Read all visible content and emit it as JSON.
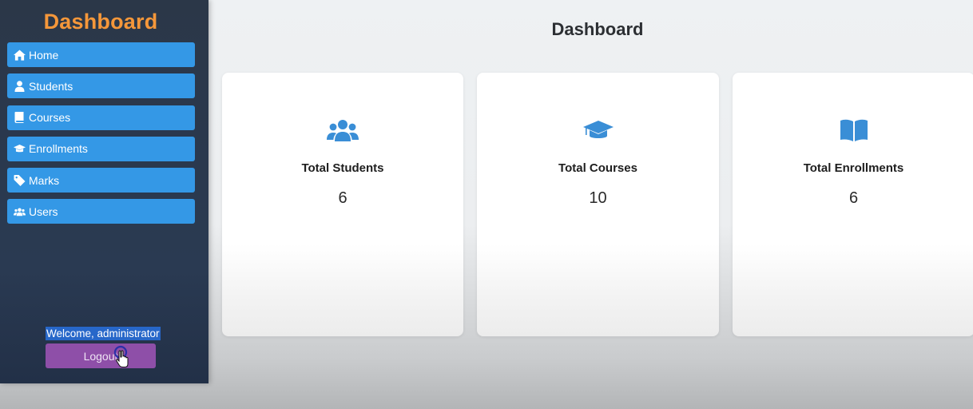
{
  "sidebar": {
    "brand": "Dashboard",
    "items": [
      {
        "label": "Home",
        "icon": "home-icon"
      },
      {
        "label": "Students",
        "icon": "user-icon"
      },
      {
        "label": "Courses",
        "icon": "book-icon"
      },
      {
        "label": "Enrollments",
        "icon": "graduation-cap-icon"
      },
      {
        "label": "Marks",
        "icon": "tag-icon"
      },
      {
        "label": "Users",
        "icon": "users-icon"
      }
    ],
    "welcome": "Welcome, administrator",
    "logout": "Logout"
  },
  "main": {
    "title": "Dashboard",
    "cards": [
      {
        "label": "Total Students",
        "value": "6",
        "icon": "users-icon"
      },
      {
        "label": "Total Courses",
        "value": "10",
        "icon": "graduation-cap-icon"
      },
      {
        "label": "Total Enrollments",
        "value": "6",
        "icon": "open-book-icon"
      }
    ]
  },
  "colors": {
    "sidebar_bg": "#2b3748",
    "brand": "#f5973a",
    "menu_button": "#3498e6",
    "logout_button": "#8e4fa8",
    "card_icon": "#3a8ed6"
  }
}
